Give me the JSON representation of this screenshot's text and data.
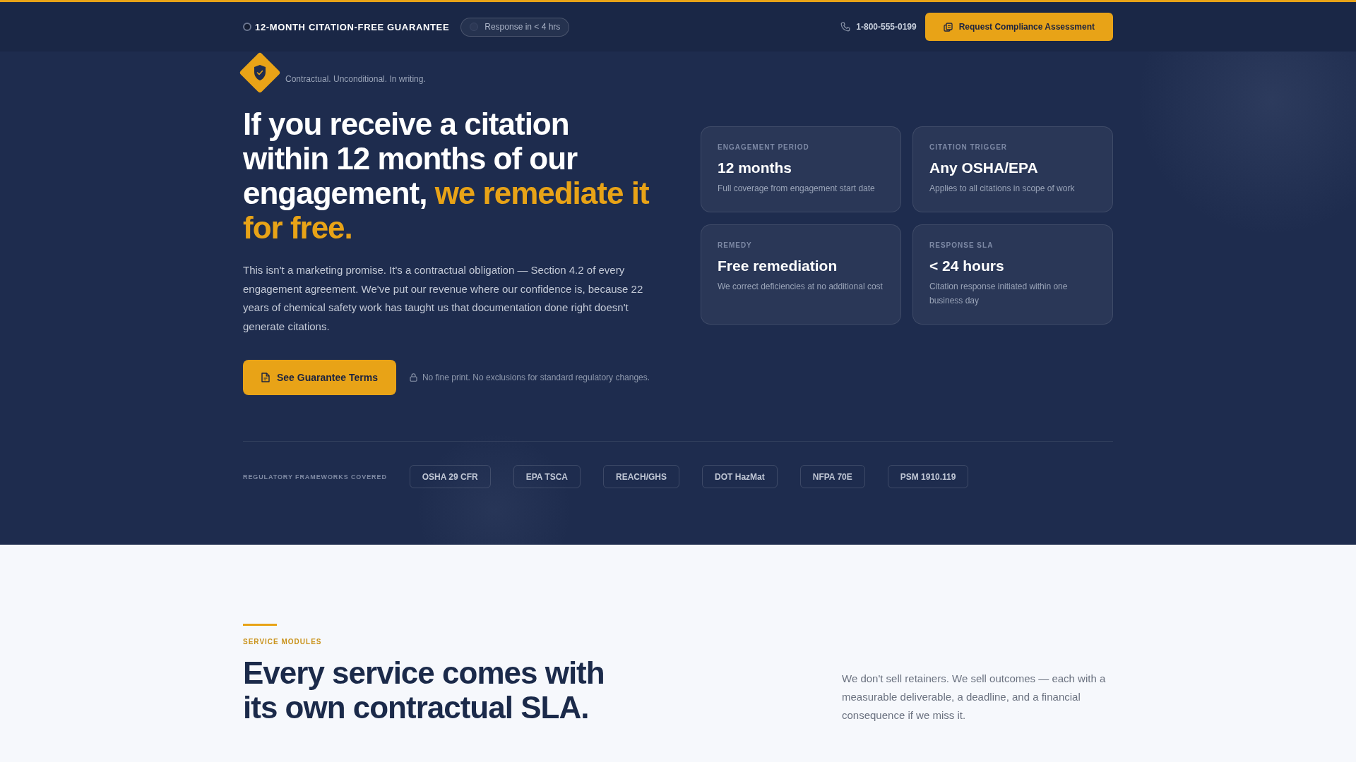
{
  "top_bar": {
    "guarantee": "12-MONTH CITATION-FREE GUARANTEE",
    "response_badge": "Response in < 4 hrs",
    "phone": "1-800-555-0199",
    "cta": "Request Compliance Assessment"
  },
  "hero": {
    "tagline": "Contractual. Unconditional. In writing.",
    "headline": [
      {
        "text": "If you receive a citation within 12 months of our engagement,",
        "highlight": false
      },
      {
        "text": "we remediate it for free.",
        "highlight": true
      }
    ],
    "body": "This isn't a marketing promise. It's a contractual obligation — Section 4.2 of every engagement agreement. We've put our revenue where our confidence is, because 22 years of chemical safety work has taught us that documentation done right doesn't generate citations.",
    "cta": "See Guarantee Terms",
    "note": "No fine print. No exclusions for standard regulatory changes.",
    "facts": [
      {
        "label": "ENGAGEMENT PERIOD",
        "value": "12 months",
        "description": "Full coverage from engagement start date"
      },
      {
        "label": "CITATION TRIGGER",
        "value": "Any OSHA/EPA",
        "description": "Applies to all citations in scope of work"
      },
      {
        "label": "REMEDY",
        "value": "Free remediation",
        "description": "We correct deficiencies at no additional cost"
      },
      {
        "label": "RESPONSE SLA",
        "value": "< 24 hours",
        "description": "Citation response initiated within one business day"
      }
    ]
  },
  "frameworks": {
    "label": "REGULATORY FRAMEWORKS COVERED",
    "items": [
      "OSHA 29 CFR",
      "EPA TSCA",
      "REACH/GHS",
      "DOT HazMat",
      "NFPA 70E",
      "PSM 1910.119"
    ]
  },
  "services": {
    "eyebrow": "SERVICE MODULES",
    "heading": "Every service comes with its own contractual SLA.",
    "intro": "We don't sell retainers. We sell outcomes — each with a measurable deliverable, a deadline, and a financial consequence if we miss it."
  }
}
